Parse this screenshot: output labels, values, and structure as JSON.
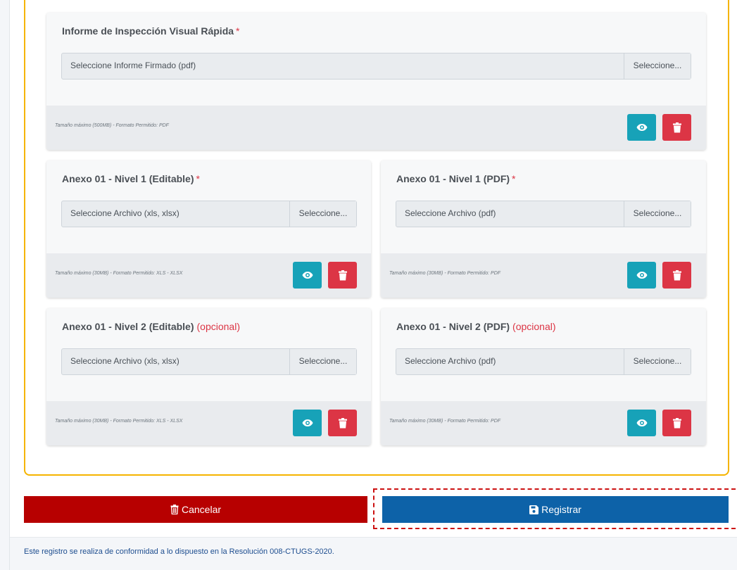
{
  "colors": {
    "outer_border": "#f5b400",
    "view_button": "#17a2b8",
    "delete_button": "#dc3545",
    "cancel_bar": "#b70000",
    "register_bar": "#0d62a8",
    "required_mark": "#dc3545"
  },
  "informe": {
    "title": "Informe de Inspección Visual Rápida",
    "required_mark": "*",
    "placeholder": "Seleccione Informe Firmado (pdf)",
    "browse": "Seleccione...",
    "footer": "Tamaño máximo (500MB)  -  Formato Permitido: PDF"
  },
  "anexos": [
    {
      "title": "Anexo 01 - Nivel 1 (Editable)",
      "required_mark": "*",
      "optional": "",
      "placeholder": "Seleccione Archivo (xls, xlsx)",
      "browse": "Seleccione...",
      "footer": "Tamaño máximo (30MB)  -  Formato Permitido: XLS - XLSX"
    },
    {
      "title": "Anexo 01 - Nivel 1 (PDF)",
      "required_mark": "*",
      "optional": "",
      "placeholder": "Seleccione Archivo (pdf)",
      "browse": "Seleccione...",
      "footer": "Tamaño máximo (30MB)  -  Formato Permitido: PDF"
    },
    {
      "title": "Anexo 01 - Nivel 2 (Editable)",
      "required_mark": "",
      "optional": "(opcional)",
      "placeholder": "Seleccione Archivo (xls, xlsx)",
      "browse": "Seleccione...",
      "footer": "Tamaño máximo (30MB)  -  Formato Permitido: XLS - XLSX"
    },
    {
      "title": "Anexo 01 - Nivel 2 (PDF)",
      "required_mark": "",
      "optional": "(opcional)",
      "placeholder": "Seleccione Archivo (pdf)",
      "browse": "Seleccione...",
      "footer": "Tamaño máximo (30MB)  -  Formato Permitido: PDF"
    }
  ],
  "actions": {
    "cancel": "Cancelar",
    "register": "Registrar"
  },
  "note": "Este registro se realiza de conformidad a lo dispuesto en la Resolución 008-CTUGS-2020.",
  "icons": {
    "view": "eye-icon",
    "delete": "trash-icon",
    "cancel": "trash-icon",
    "register": "save-icon"
  }
}
